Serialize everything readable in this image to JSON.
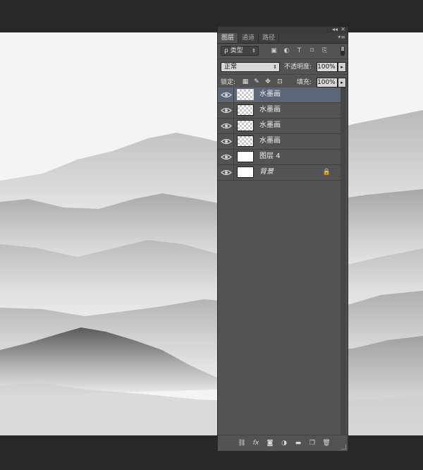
{
  "panel": {
    "tabs": [
      {
        "label": "图层"
      },
      {
        "label": "通道"
      },
      {
        "label": "路径"
      }
    ],
    "filter": {
      "label": "ρ 类型"
    },
    "blend_mode": "正常",
    "opacity_label": "不透明度:",
    "opacity_value": "100%",
    "lock_label": "锁定:",
    "fill_label": "填充:",
    "fill_value": "100%",
    "layers": [
      {
        "name": "水墨画",
        "selected": true,
        "visible": true,
        "thumb": "transparent"
      },
      {
        "name": "水墨画",
        "selected": false,
        "visible": true,
        "thumb": "transparent"
      },
      {
        "name": "水墨画",
        "selected": false,
        "visible": true,
        "thumb": "transparent"
      },
      {
        "name": "水墨画",
        "selected": false,
        "visible": true,
        "thumb": "transparent"
      },
      {
        "name": "图层 4",
        "selected": false,
        "visible": true,
        "thumb": "white"
      },
      {
        "name": "背景",
        "selected": false,
        "visible": true,
        "thumb": "white",
        "locked": true
      }
    ]
  },
  "colors": {
    "selected_layer": "#5b6678",
    "panel_bg": "#535353",
    "app_bg": "#282828"
  }
}
